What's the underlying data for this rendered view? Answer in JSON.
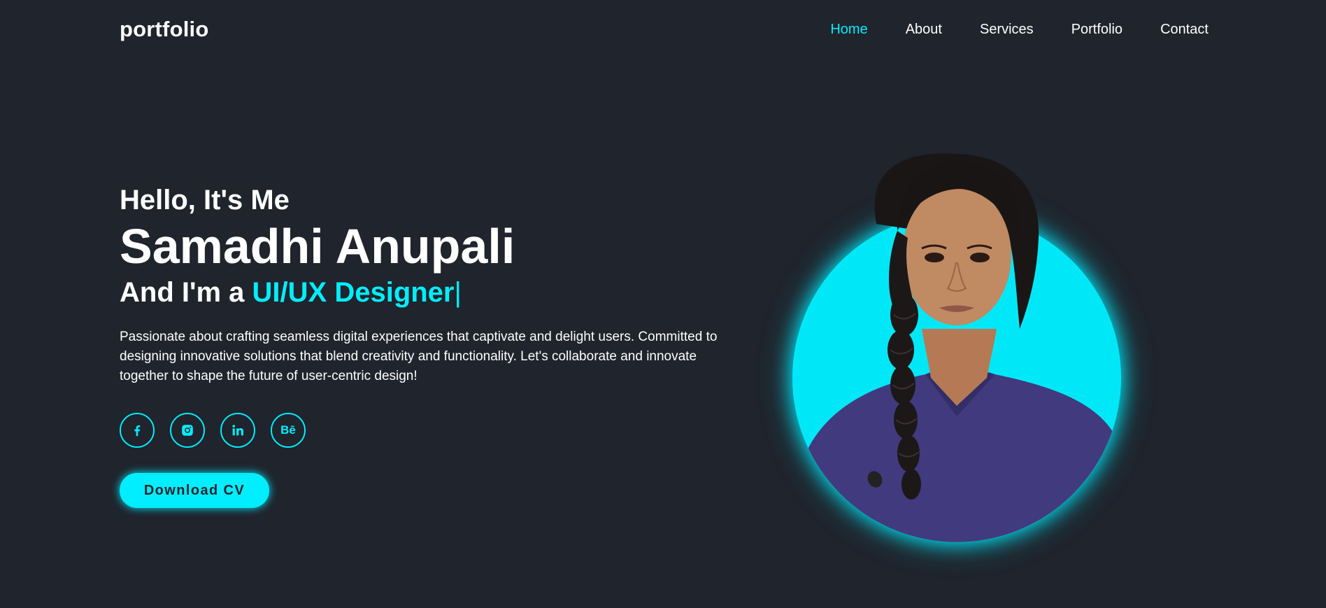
{
  "header": {
    "logo": "portfolio",
    "nav": [
      "Home",
      "About",
      "Services",
      "Portfolio",
      "Contact"
    ],
    "active_nav": "Home"
  },
  "hero": {
    "greeting": "Hello, It's Me",
    "name": "Samadhi Anupali",
    "role_prefix": "And I'm a ",
    "role": "UI/UX Designer",
    "cursor": "|",
    "description": "Passionate about crafting seamless digital experiences that captivate and delight users. Committed to designing innovative solutions that blend creativity and functionality. Let's collaborate and innovate together to shape the future of user-centric design!",
    "socials": [
      {
        "icon": "facebook-icon"
      },
      {
        "icon": "instagram-icon"
      },
      {
        "icon": "linkedin-icon"
      },
      {
        "icon": "behance-icon",
        "label": "Bē"
      }
    ],
    "cta": "Download CV"
  },
  "colors": {
    "background": "#1f242d",
    "accent": "#00eeff",
    "text": "#ffffff"
  }
}
